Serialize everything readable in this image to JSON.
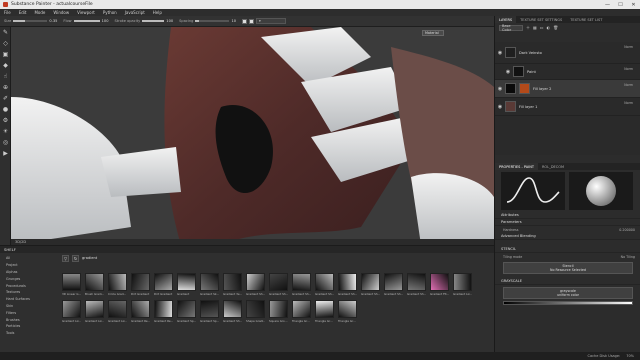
{
  "window": {
    "title": "Substance Painter - actualcourseFile"
  },
  "menu": [
    "File",
    "Edit",
    "Mode",
    "Window",
    "Viewport",
    "Python",
    "JavaScript",
    "Help"
  ],
  "toolbar": {
    "size_label": "Size",
    "size_value": "0.35",
    "flow_label": "Flow",
    "flow_value": "100",
    "stroke_opacity_label": "Stroke opacity",
    "stroke_opacity_value": "100",
    "spacing_label": "Spacing",
    "spacing_value": "10",
    "size_fill": 0.35,
    "flow_fill": 1.0,
    "stroke_fill": 1.0,
    "spacing_fill": 0.1
  },
  "viewport": {
    "material_dropdown": "Material",
    "bottom_label": "3D/2D"
  },
  "shelf": {
    "title": "SHELF",
    "search_query": "gradient",
    "categories": [
      "All",
      "Project",
      "Alphas",
      "Grunges",
      "Procedurals",
      "Textures",
      "Hard Surfaces",
      "Skin",
      "Filters",
      "Brushes",
      "Particles",
      "Tools"
    ],
    "items": [
      "3D Linear G…",
      "Brush Gradi…",
      "Circle Grad…",
      "Dirt Gradient",
      "Dirt Gradient",
      "Gradient",
      "Gradient Sk…",
      "Gradient 3e…",
      "Gradient Sh…",
      "Gradient Sh…",
      "Gradient Sh…",
      "Gradient Sh…",
      "Gradient Sh…",
      "Gradient Sh…",
      "Gradient Sh…",
      "Gradient Sh…",
      "Gradient Flt…",
      "Gradient Lin…",
      "Gradient Lin…",
      "Gradient Lin…",
      "Gradient Lin…",
      "Gradient Re…",
      "Gradient Re…",
      "Gradient Sp…",
      "Gradient Sp…",
      "Gradient Sh…",
      "Shape Gradi…",
      "Square Gro…",
      "Triangle Gr…",
      "Triangle Gr…",
      "Triangle Gr…"
    ]
  },
  "layers_panel": {
    "tabs": [
      "LAYERS",
      "TEXTURE SET SETTINGS",
      "TEXTURE SET LIST"
    ],
    "channel": "Base Color",
    "layers": [
      {
        "name": "Dark Veinsto",
        "blend": "Norm",
        "opacity": "100"
      },
      {
        "name": "Paint",
        "blend": "Norm",
        "opacity": "100"
      },
      {
        "name": "Fill layer 2",
        "blend": "Norm",
        "opacity": "100"
      },
      {
        "name": "Fill layer 1",
        "blend": "Norm",
        "opacity": "100"
      }
    ]
  },
  "properties": {
    "tabs": [
      "PROPERTIES - PAINT",
      "ROL_DECOM"
    ],
    "attributes": "Attributes",
    "parameters": "Parameters",
    "hardness_label": "Hardness",
    "hardness_value": "0.200000",
    "advanced": "Advanced Blending",
    "stencil": "STENCIL",
    "tiling_label": "Tiling mode",
    "tiling_value": "No Tiling",
    "stencil_btn": "Stencil",
    "stencil_sub": "No Resource Selected",
    "grayscale": "GRAYSCALE",
    "gray_btn": "grayscale",
    "gray_sub": "uniform color"
  },
  "status": {
    "cache": "Cache Disk Usage:",
    "zoom": "70%"
  }
}
